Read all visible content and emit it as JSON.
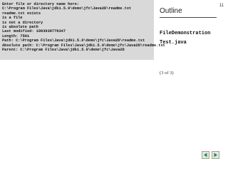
{
  "console": {
    "lines": [
      "Enter file or directory name here:",
      "C:\\Program Files\\Java\\jdk1.5.0\\demo\\jfc\\Java2D\\readme.txt",
      "readme.txt exists",
      "is a file",
      "is not a directory",
      "is absolute path",
      "Last modified: 1083938778347",
      "Length: 7501",
      "Path: C:\\Program Files\\Java\\jdk1.5.0\\demo\\jfc\\Java2D\\readme.txt",
      "Absolute path: C:\\Program Files\\Java\\jdk1.5.0\\demo\\jfc\\Java2D\\readme.txt",
      "Parent: C:\\Program Files\\Java\\jdk1.5.0\\demo\\jfc\\Java2D"
    ]
  },
  "slide": {
    "page_number": "11",
    "outline_title": "Outline",
    "outline_items": [
      "FileDemonstration",
      "Test.java"
    ],
    "page_count": "(3 of 3)"
  },
  "nav": {
    "prev_icon": "left-arrow-icon",
    "next_icon": "right-arrow-icon",
    "button_fill": "#e3e7dd",
    "arrow_color": "#2e7d7a"
  }
}
